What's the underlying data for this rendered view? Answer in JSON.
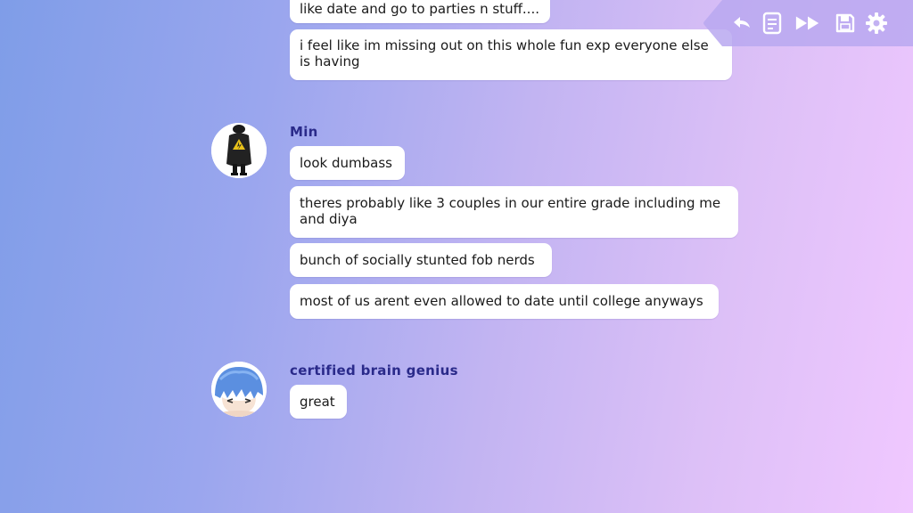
{
  "messages": [
    {
      "speaker": "",
      "bubbles": [
        "like date and go to parties n stuff....",
        "i feel like im missing out on this whole fun exp everyone else is having"
      ]
    },
    {
      "speaker": "Min",
      "avatar_icon": "dark-figure-avatar-icon",
      "bubbles": [
        "look dumbass",
        "theres probably like 3 couples in our entire grade including me and diya",
        "bunch of socially stunted fob nerds",
        "most of us arent even allowed to date until college anyways"
      ]
    },
    {
      "speaker": "certified brain genius",
      "avatar_icon": "blue-hair-anime-avatar-icon",
      "bubbles": [
        "great"
      ]
    }
  ],
  "quick_menu": {
    "buttons": [
      "back-icon",
      "history-icon",
      "skip-icon",
      "save-icon",
      "settings-icon"
    ],
    "icon_color": "#ffffff"
  },
  "colors": {
    "name_color": "#2a2a8a",
    "bubble_bg": "#ffffff",
    "bg_left": "#7f9de8",
    "bg_right": "#f0c8ff"
  }
}
